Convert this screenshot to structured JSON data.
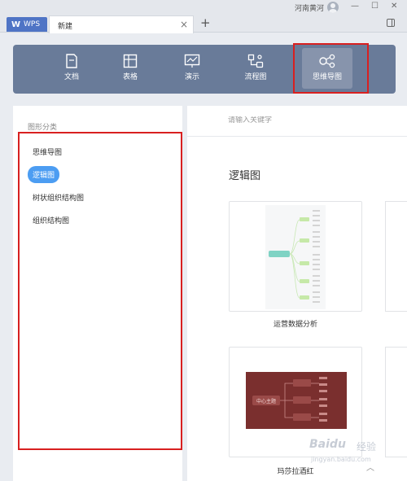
{
  "titlebar": {
    "app_tab": "WPS",
    "doc_tab": "新建",
    "close_glyph": "×",
    "new_tab_glyph": "+",
    "username": "河南黄河",
    "minimize": "—",
    "maximize": "☐",
    "close": "✕"
  },
  "categories": [
    {
      "label": "文档",
      "icon": "document-icon"
    },
    {
      "label": "表格",
      "icon": "table-icon"
    },
    {
      "label": "演示",
      "icon": "presentation-icon"
    },
    {
      "label": "流程图",
      "icon": "flowchart-icon"
    },
    {
      "label": "思维导图",
      "icon": "mindmap-icon",
      "active": true
    }
  ],
  "sidebar": {
    "title": "图形分类",
    "items": [
      {
        "label": "思维导图"
      },
      {
        "label": "逻辑图",
        "active": true
      },
      {
        "label": "树状组织结构图"
      },
      {
        "label": "组织结构图"
      }
    ]
  },
  "main": {
    "search_placeholder": "请输入关键字",
    "section_title": "逻辑图",
    "templates": [
      {
        "label": "运营数据分析"
      },
      {
        "label": "玛莎拉酒红",
        "center_text": "中心主题"
      }
    ]
  },
  "scroll_up": "︿",
  "watermark": {
    "brand": "Baidu",
    "sub": "经验",
    "url": "jingyan.baidu.com"
  },
  "colors": {
    "category_bar": "#697b99",
    "active_pill": "#4c9df2",
    "highlight": "#d82020",
    "template2_bg": "#7a2f2e"
  }
}
